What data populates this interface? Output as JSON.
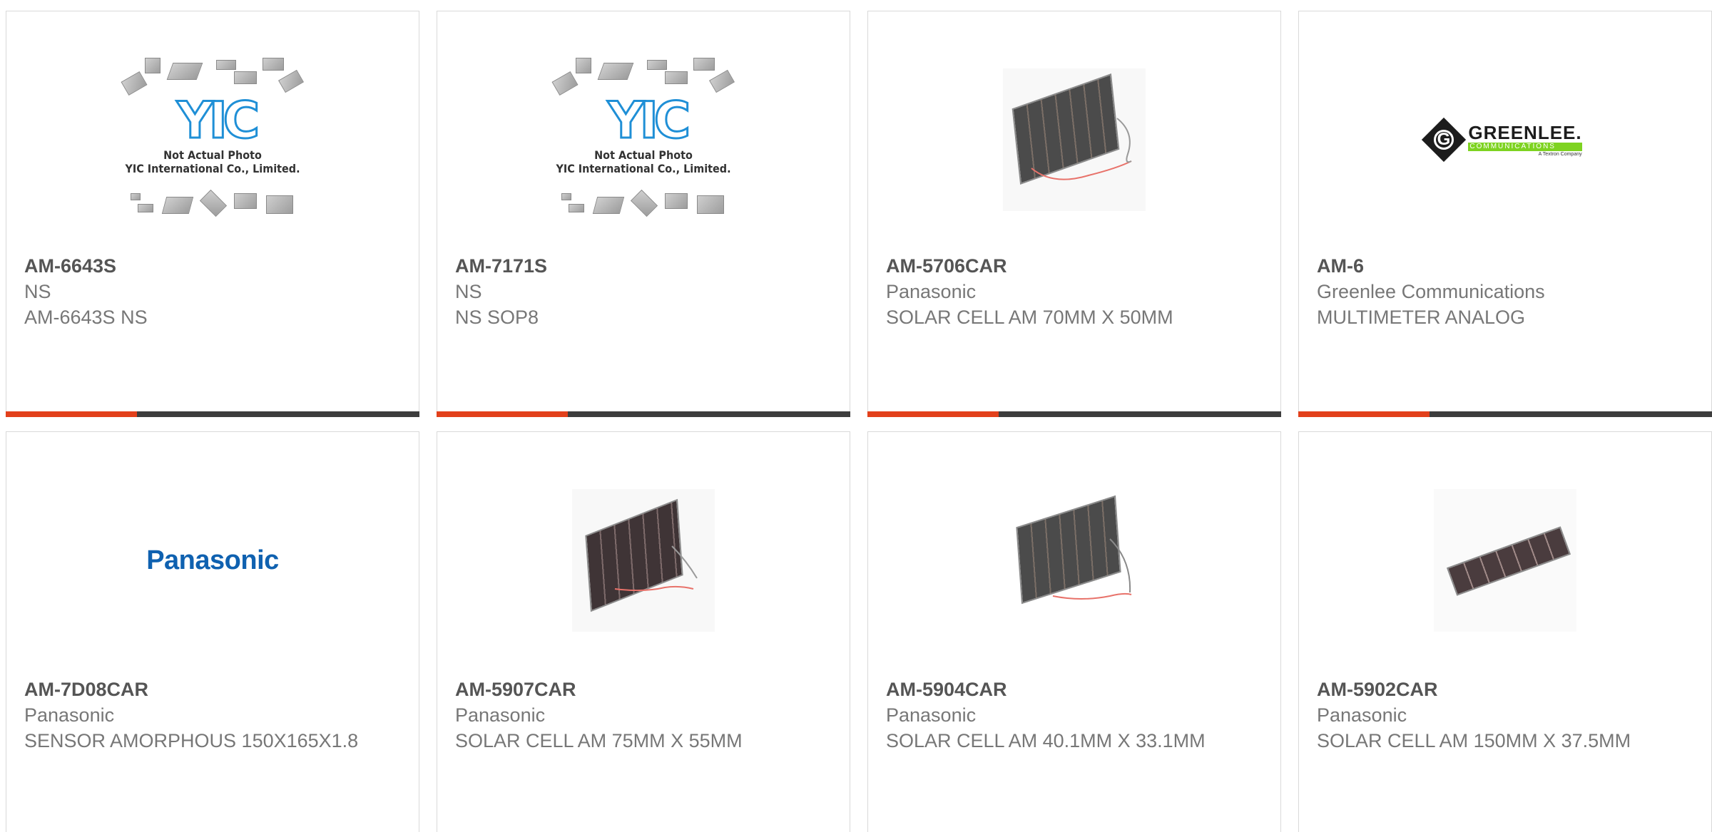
{
  "products": [
    {
      "part": "AM-6643S",
      "manufacturer": "NS",
      "description": "AM-6643S NS",
      "image": "yic-not-actual-photo"
    },
    {
      "part": "AM-7171S",
      "manufacturer": "NS",
      "description": "NS SOP8",
      "image": "yic-not-actual-photo"
    },
    {
      "part": "AM-5706CAR",
      "manufacturer": "Panasonic",
      "description": "SOLAR CELL AM 70MM X 50MM",
      "image": "solar-cell-photo"
    },
    {
      "part": "AM-6",
      "manufacturer": "Greenlee Communications",
      "description": "MULTIMETER ANALOG",
      "image": "greenlee-logo"
    },
    {
      "part": "AM-7D08CAR",
      "manufacturer": "Panasonic",
      "description": "SENSOR AMORPHOUS 150X165X1.8",
      "image": "panasonic-logo"
    },
    {
      "part": "AM-5907CAR",
      "manufacturer": "Panasonic",
      "description": "SOLAR CELL AM 75MM X 55MM",
      "image": "solar-cell-photo"
    },
    {
      "part": "AM-5904CAR",
      "manufacturer": "Panasonic",
      "description": "SOLAR CELL AM 40.1MM X 33.1MM",
      "image": "solar-cell-photo"
    },
    {
      "part": "AM-5902CAR",
      "manufacturer": "Panasonic",
      "description": "SOLAR CELL AM 150MM X 37.5MM",
      "image": "solar-cell-photo"
    }
  ],
  "placeholder": {
    "logo_text": "YIC",
    "caption_line1": "Not Actual Photo",
    "caption_line2": "YIC International Co., Limited."
  },
  "greenlee_logo": {
    "mark": "G",
    "word": "GREENLEE.",
    "sub": "COMMUNICATIONS",
    "tag": "A Textron Company"
  },
  "panasonic_logo": {
    "word": "Panasonic"
  },
  "colors": {
    "accent": "#e2401b",
    "bar": "#3d3d3d",
    "part_text": "#555555",
    "body_text": "#777777",
    "panasonic_blue": "#0f61b0",
    "greenlee_green": "#7ed321",
    "yic_blue": "#1f8fd6"
  }
}
